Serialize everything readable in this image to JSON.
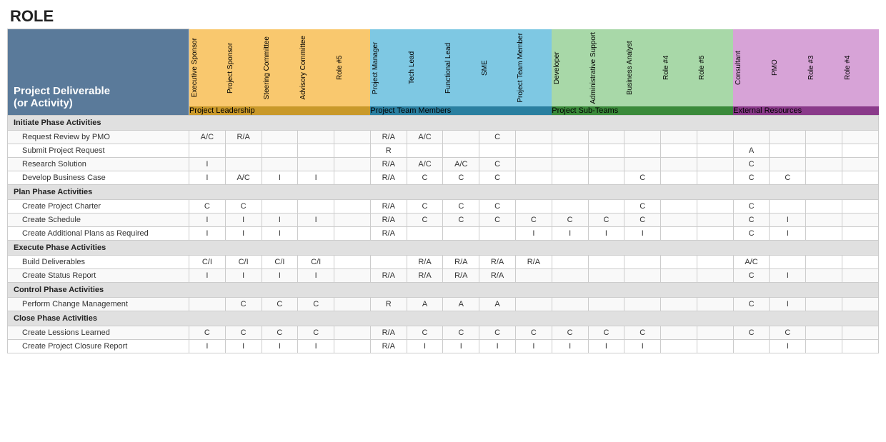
{
  "title": "ROLE",
  "activityColumnLabel": "Project Deliverable\n(or Activity)",
  "groupLabels": [
    {
      "id": "leadership",
      "label": "Project Leadership",
      "span": 5,
      "colorClass": "gl-leadership"
    },
    {
      "id": "team",
      "label": "Project Team Members",
      "span": 5,
      "colorClass": "gl-team"
    },
    {
      "id": "subteams",
      "label": "Project Sub-Teams",
      "span": 5,
      "colorClass": "gl-subteams"
    },
    {
      "id": "external",
      "label": "External Resources",
      "span": 4,
      "colorClass": "gl-external"
    }
  ],
  "roles": [
    {
      "label": "Executive Sponsor",
      "group": "leadership",
      "colorClass": "rc-leadership"
    },
    {
      "label": "Project Sponsor",
      "group": "leadership",
      "colorClass": "rc-leadership"
    },
    {
      "label": "Steering Committee",
      "group": "leadership",
      "colorClass": "rc-leadership"
    },
    {
      "label": "Advisory Committee",
      "group": "leadership",
      "colorClass": "rc-leadership"
    },
    {
      "label": "Role #5",
      "group": "leadership",
      "colorClass": "rc-leadership"
    },
    {
      "label": "Project Manager",
      "group": "team",
      "colorClass": "rc-team"
    },
    {
      "label": "Tech Lead",
      "group": "team",
      "colorClass": "rc-team"
    },
    {
      "label": "Functional Lead",
      "group": "team",
      "colorClass": "rc-team"
    },
    {
      "label": "SME",
      "group": "team",
      "colorClass": "rc-team"
    },
    {
      "label": "Project Team Member",
      "group": "team",
      "colorClass": "rc-team"
    },
    {
      "label": "Developer",
      "group": "subteams",
      "colorClass": "rc-subteams"
    },
    {
      "label": "Administrative Support",
      "group": "subteams",
      "colorClass": "rc-subteams"
    },
    {
      "label": "Business Analyst",
      "group": "subteams",
      "colorClass": "rc-subteams"
    },
    {
      "label": "Role #4",
      "group": "subteams",
      "colorClass": "rc-subteams"
    },
    {
      "label": "Role #5",
      "group": "subteams",
      "colorClass": "rc-subteams"
    },
    {
      "label": "Consultant",
      "group": "external",
      "colorClass": "rc-external"
    },
    {
      "label": "PMO",
      "group": "external",
      "colorClass": "rc-external"
    },
    {
      "label": "Role #3",
      "group": "external",
      "colorClass": "rc-external"
    },
    {
      "label": "Role #4",
      "group": "external",
      "colorClass": "rc-external"
    }
  ],
  "phases": [
    {
      "phase": "Initiate Phase Activities",
      "activities": [
        {
          "name": "Request Review by PMO",
          "values": [
            "A/C",
            "R/A",
            "",
            "",
            "",
            "R/A",
            "A/C",
            "",
            "C",
            "",
            "",
            "",
            "",
            "",
            "",
            "",
            "",
            "",
            ""
          ]
        },
        {
          "name": "Submit Project Request",
          "values": [
            "",
            "",
            "",
            "",
            "",
            "R",
            "",
            "",
            "",
            "",
            "",
            "",
            "",
            "",
            "",
            "A",
            "",
            "",
            ""
          ]
        },
        {
          "name": "Research Solution",
          "values": [
            "I",
            "",
            "",
            "",
            "",
            "R/A",
            "A/C",
            "A/C",
            "C",
            "",
            "",
            "",
            "",
            "",
            "",
            "C",
            "",
            "",
            ""
          ]
        },
        {
          "name": "Develop Business Case",
          "values": [
            "I",
            "A/C",
            "I",
            "I",
            "",
            "R/A",
            "C",
            "C",
            "C",
            "",
            "",
            "",
            "C",
            "",
            "",
            "C",
            "C",
            "",
            ""
          ]
        }
      ]
    },
    {
      "phase": "Plan Phase Activities",
      "activities": [
        {
          "name": "Create Project Charter",
          "values": [
            "C",
            "C",
            "",
            "",
            "",
            "R/A",
            "C",
            "C",
            "C",
            "",
            "",
            "",
            "C",
            "",
            "",
            "C",
            "",
            "",
            ""
          ]
        },
        {
          "name": "Create Schedule",
          "values": [
            "I",
            "I",
            "I",
            "I",
            "",
            "R/A",
            "C",
            "C",
            "C",
            "C",
            "C",
            "C",
            "C",
            "",
            "",
            "C",
            "I",
            "",
            ""
          ]
        },
        {
          "name": "Create Additional Plans as Required",
          "values": [
            "I",
            "I",
            "I",
            "",
            "",
            "R/A",
            "",
            "",
            "",
            "I",
            "I",
            "I",
            "I",
            "",
            "",
            "C",
            "I",
            "",
            ""
          ]
        }
      ]
    },
    {
      "phase": "Execute Phase Activities",
      "activities": [
        {
          "name": "Build Deliverables",
          "values": [
            "C/I",
            "C/I",
            "C/I",
            "C/I",
            "",
            "",
            "R/A",
            "R/A",
            "R/A",
            "R/A",
            "",
            "",
            "",
            "",
            "",
            "A/C",
            "",
            "",
            ""
          ]
        },
        {
          "name": "Create Status Report",
          "values": [
            "I",
            "I",
            "I",
            "I",
            "",
            "R/A",
            "R/A",
            "R/A",
            "R/A",
            "",
            "",
            "",
            "",
            "",
            "",
            "C",
            "I",
            "",
            ""
          ]
        }
      ]
    },
    {
      "phase": "Control Phase Activities",
      "activities": [
        {
          "name": "Perform Change Management",
          "values": [
            "",
            "C",
            "C",
            "C",
            "",
            "R",
            "A",
            "A",
            "A",
            "",
            "",
            "",
            "",
            "",
            "",
            "C",
            "I",
            "",
            ""
          ]
        }
      ]
    },
    {
      "phase": "Close Phase Activities",
      "activities": [
        {
          "name": "Create Lessions Learned",
          "values": [
            "C",
            "C",
            "C",
            "C",
            "",
            "R/A",
            "C",
            "C",
            "C",
            "C",
            "C",
            "C",
            "C",
            "",
            "",
            "C",
            "C",
            "",
            ""
          ]
        },
        {
          "name": "Create Project Closure Report",
          "values": [
            "I",
            "I",
            "I",
            "I",
            "",
            "R/A",
            "I",
            "I",
            "I",
            "I",
            "I",
            "I",
            "I",
            "",
            "",
            "",
            "I",
            "",
            ""
          ]
        }
      ]
    }
  ]
}
